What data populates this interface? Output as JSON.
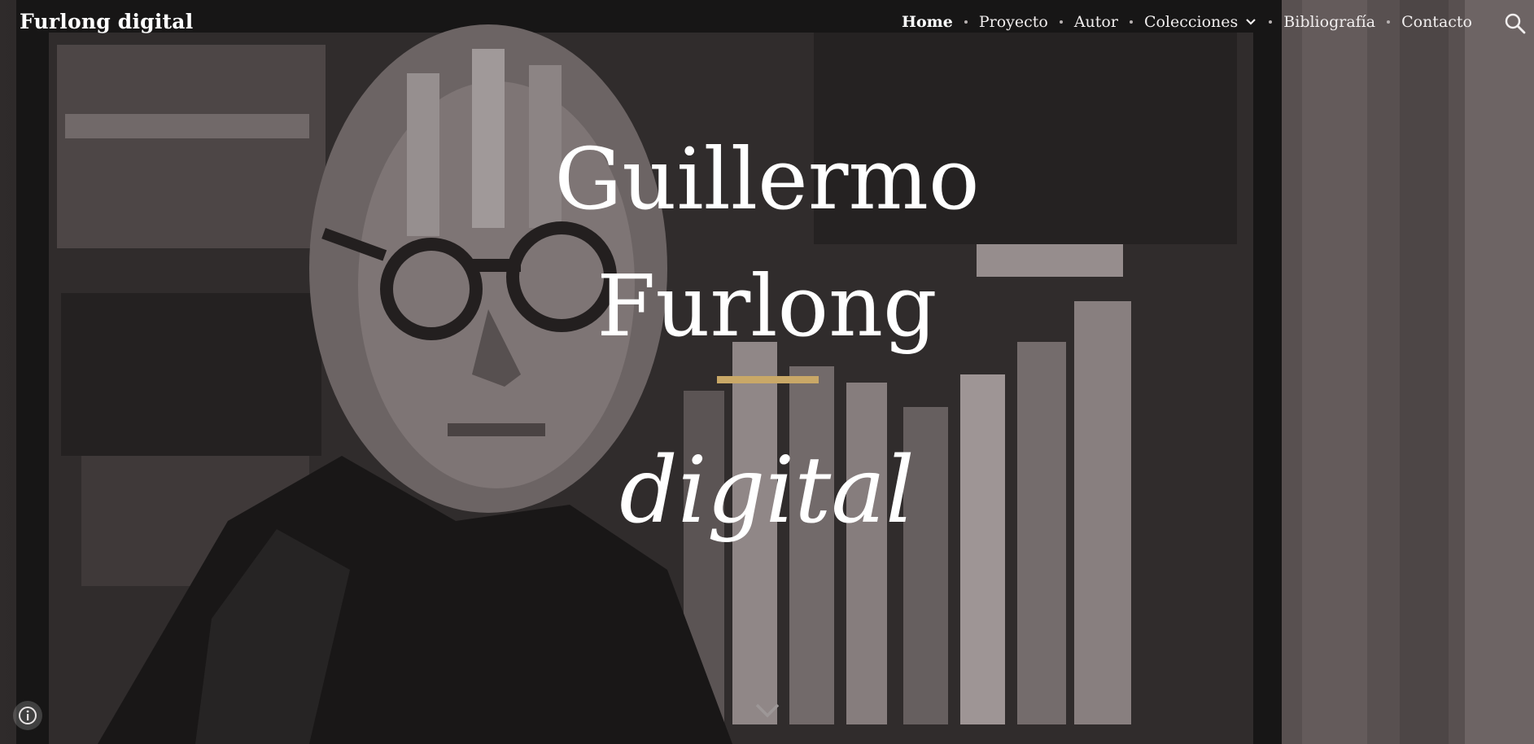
{
  "site": {
    "title": "Furlong digital"
  },
  "nav": {
    "items": [
      {
        "label": "Home",
        "active": true
      },
      {
        "label": "Proyecto"
      },
      {
        "label": "Autor"
      },
      {
        "label": "Colecciones",
        "has_dropdown": true
      },
      {
        "label": "Bibliografía"
      },
      {
        "label": "Contacto"
      }
    ],
    "search_icon": "search-icon"
  },
  "hero": {
    "title_line1": "Guillermo",
    "title_line2": "Furlong",
    "subtitle": "digital",
    "accent_color": "#c9a867",
    "background_image": "painted-portrait-man-with-glasses-bookshelf"
  },
  "controls": {
    "scroll_icon": "chevron-down-icon",
    "info_icon": "info-icon"
  }
}
